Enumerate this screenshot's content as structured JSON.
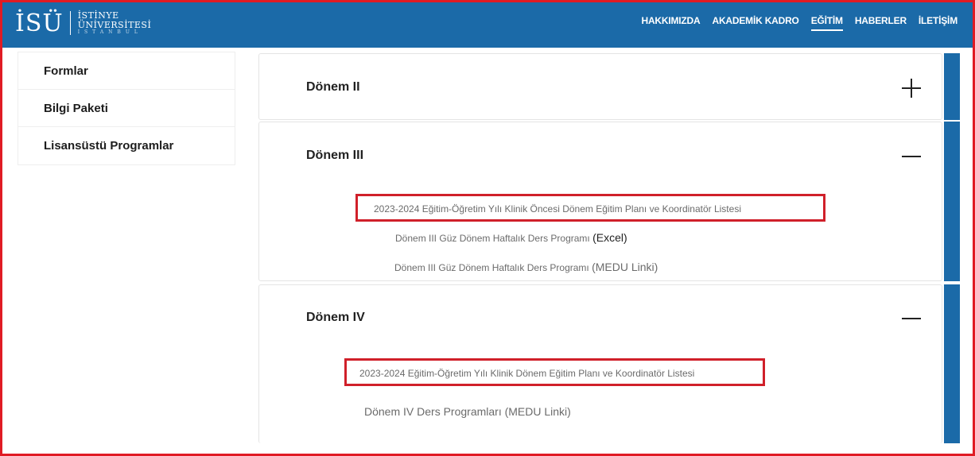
{
  "colors": {
    "brand": "#1b6aa8",
    "highlight": "#d0202a",
    "frame": "#e01b24"
  },
  "logo": {
    "mark": "İSÜ",
    "line1": "İSTİNYE",
    "line2": "ÜNİVERSİTESİ",
    "line3": "İSTANBUL"
  },
  "nav": {
    "items": [
      {
        "label": "HAKKIMIZDA"
      },
      {
        "label": "AKADEMİK KADRO"
      },
      {
        "label": "EĞİTİM"
      },
      {
        "label": "HABERLER"
      },
      {
        "label": "İLETİŞİM"
      }
    ],
    "active": "EĞİTİM"
  },
  "sidebar": {
    "items": [
      {
        "label": "Formlar"
      },
      {
        "label": "Bilgi Paketi"
      },
      {
        "label": "Lisansüstü Programlar"
      }
    ]
  },
  "accordion": {
    "panels": [
      {
        "title": "Dönem II",
        "state": "collapsed",
        "icon": "plus-icon"
      },
      {
        "title": "Dönem III",
        "state": "expanded",
        "icon": "minus-icon",
        "links": [
          {
            "text": "2023-2024 Eğitim-Öğretim Yılı Klinik Öncesi Dönem Eğitim Planı ve Koordinatör Listesi",
            "highlighted": true
          },
          {
            "text": "Dönem III Güz Dönem  Haftalık Ders Programı ",
            "suffix": "(Excel)"
          },
          {
            "text": "Dönem III Güz Dönem  Haftalık Ders Programı ",
            "suffix": "(MEDU Linki)"
          }
        ]
      },
      {
        "title": "Dönem IV",
        "state": "expanded",
        "icon": "minus-icon",
        "links": [
          {
            "text": "2023-2024 Eğitim-Öğretim Yılı Klinik Dönem Eğitim Planı ve Koordinatör Listesi",
            "highlighted": true
          },
          {
            "text": "Dönem IV Ders Programları (MEDU Linki)"
          }
        ]
      }
    ]
  }
}
